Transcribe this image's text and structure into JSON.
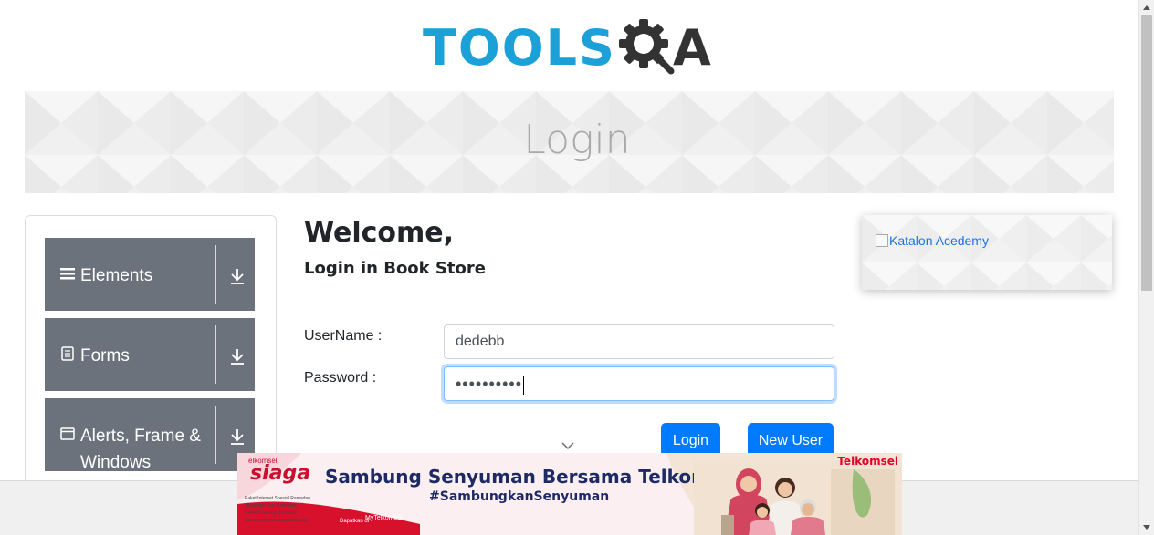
{
  "header": {
    "logo_text_left": "TOOLS",
    "logo_text_right": "A",
    "logo_icon": "gear-search-icon"
  },
  "banner": {
    "title": "Login"
  },
  "sidebar": {
    "groups": [
      {
        "label": "Elements",
        "icon": "hamburger-icon"
      },
      {
        "label": "Forms",
        "icon": "document-icon"
      },
      {
        "label": "Alerts, Frame & Windows",
        "icon": "window-icon"
      }
    ],
    "expand_icon": "download-arrow-icon"
  },
  "main": {
    "welcome": "Welcome,",
    "subtitle": "Login in Book Store",
    "username_label": "UserName :",
    "username_value": "dedebb",
    "password_label": "Password :",
    "password_masked": "••••••••••",
    "login_button": "Login",
    "new_user_button": "New User"
  },
  "right_ad": {
    "alt_text": "Katalon Acedemy"
  },
  "promo": {
    "brand_small": "Telkomsel",
    "brand": "siaga",
    "headline": "Sambung Senyuman Bersama Telkomsel",
    "hashtag": "#SambungkanSenyuman",
    "telkomsel_logo": "Telkomsel",
    "download_text": "Dapatkan di",
    "app_name": "MyTelkomsel",
    "list_items": [
      "Paket Internet Spesial Ramadan",
      "Telkomsel Poin Ramadan",
      "Paket Roaming Ramadan",
      "dan banyak penawaran lainnya"
    ]
  },
  "colors": {
    "brand_blue": "#1ba0d8",
    "accordion_gray": "#6b727c",
    "button_blue": "#007bff",
    "telkomsel_red": "#e4002b"
  }
}
